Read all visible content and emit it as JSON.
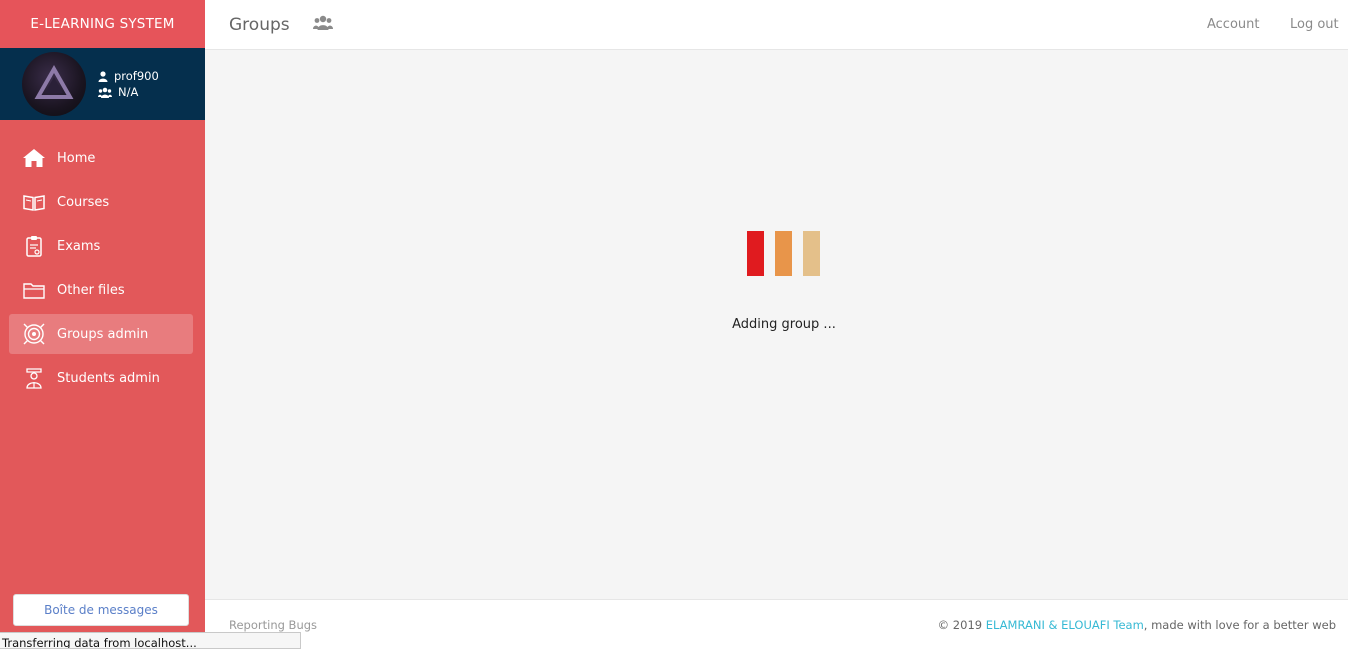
{
  "app": {
    "brand": "E-LEARNING SYSTEM"
  },
  "user": {
    "username": "prof900",
    "group": "N/A"
  },
  "nav": {
    "items": [
      {
        "label": "Home",
        "icon": "home-icon"
      },
      {
        "label": "Courses",
        "icon": "book-icon"
      },
      {
        "label": "Exams",
        "icon": "clipboard-icon"
      },
      {
        "label": "Other files",
        "icon": "folder-icon"
      },
      {
        "label": "Groups admin",
        "icon": "target-icon",
        "active": true
      },
      {
        "label": "Students admin",
        "icon": "student-icon"
      }
    ]
  },
  "inbox": {
    "label": "Boîte de messages"
  },
  "header": {
    "title": "Groups",
    "icon": "users-icon",
    "account_label": "Account",
    "logout_label": "Log out"
  },
  "loader": {
    "text": "Adding group ...",
    "colors": [
      "#e01b1f",
      "#e8954a",
      "#e4c08a"
    ]
  },
  "footer": {
    "report_label": "Reporting Bugs",
    "copyright_prefix": "© 2019 ",
    "team_label": "ELAMRANI & ELOUAFI Team",
    "copyright_suffix": ", made with love for a better web"
  },
  "statusbar": {
    "text": "Transferring data from localhost..."
  },
  "colors": {
    "sidebar": "#e2585a",
    "user_box": "#052f4d",
    "accent_link": "#36b9d4"
  }
}
